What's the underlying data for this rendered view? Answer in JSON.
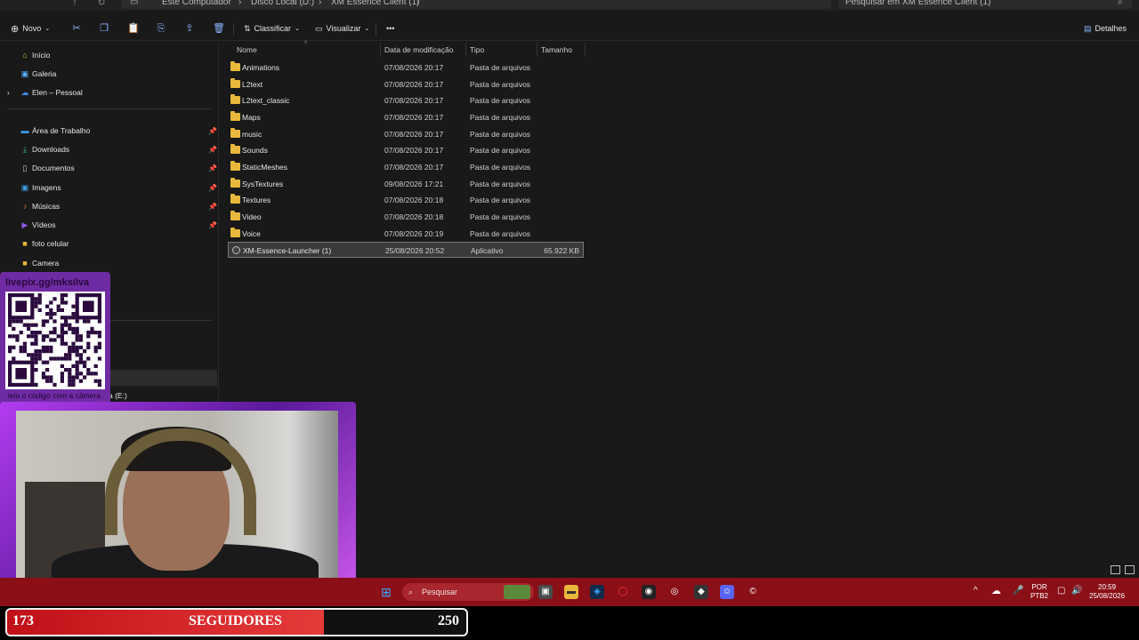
{
  "address": {
    "crumbs": [
      "Este Computador",
      "Disco Local (D:)",
      "XM Essence Client (1)"
    ],
    "search_placeholder": "Pesquisar em XM Essence Client (1)"
  },
  "toolbar": {
    "new_label": "Novo",
    "sort_label": "Classificar",
    "view_label": "Visualizar",
    "more_label": "•••",
    "details_label": "Detalhes"
  },
  "nav": {
    "items": [
      {
        "label": "Início",
        "icon": "home-icon",
        "color": "#e8b83c"
      },
      {
        "label": "Galeria",
        "icon": "gallery-icon",
        "color": "#5ab0ff"
      },
      {
        "label": "Elen – Pessoal",
        "icon": "cloud-icon",
        "color": "#3a8ee8"
      },
      {
        "label": "Área de Trabalho",
        "icon": "desktop-icon",
        "color": "#3a9ee8"
      },
      {
        "label": "Downloads",
        "icon": "download-icon",
        "color": "#3ac89a"
      },
      {
        "label": "Documentos",
        "icon": "document-icon",
        "color": "#c8c8c8"
      },
      {
        "label": "Imagens",
        "icon": "image-icon",
        "color": "#3a9ee8"
      },
      {
        "label": "Músicas",
        "icon": "music-icon",
        "color": "#e86a4a"
      },
      {
        "label": "Vídeos",
        "icon": "video-icon",
        "color": "#8a5ae8"
      },
      {
        "label": "foto celular",
        "icon": "folder-icon",
        "color": "#e8b83c"
      },
      {
        "label": "Camera",
        "icon": "folder-icon",
        "color": "#e8b83c"
      }
    ],
    "drive_label": "a (E:)"
  },
  "columns": {
    "name": "Nome",
    "modified": "Data de modificação",
    "type": "Tipo",
    "size": "Tamanho"
  },
  "files": [
    {
      "name": "Animations",
      "modified": "07/08/2026 20:17",
      "type": "Pasta de arquivos",
      "size": ""
    },
    {
      "name": "L2text",
      "modified": "07/08/2026 20:17",
      "type": "Pasta de arquivos",
      "size": ""
    },
    {
      "name": "L2text_classic",
      "modified": "07/08/2026 20:17",
      "type": "Pasta de arquivos",
      "size": ""
    },
    {
      "name": "Maps",
      "modified": "07/08/2026 20:17",
      "type": "Pasta de arquivos",
      "size": ""
    },
    {
      "name": "music",
      "modified": "07/08/2026 20:17",
      "type": "Pasta de arquivos",
      "size": ""
    },
    {
      "name": "Sounds",
      "modified": "07/08/2026 20:17",
      "type": "Pasta de arquivos",
      "size": ""
    },
    {
      "name": "StaticMeshes",
      "modified": "07/08/2026 20:17",
      "type": "Pasta de arquivos",
      "size": ""
    },
    {
      "name": "SysTextures",
      "modified": "09/08/2026 17:21",
      "type": "Pasta de arquivos",
      "size": ""
    },
    {
      "name": "Textures",
      "modified": "07/08/2026 20:18",
      "type": "Pasta de arquivos",
      "size": ""
    },
    {
      "name": "Video",
      "modified": "07/08/2026 20:18",
      "type": "Pasta de arquivos",
      "size": ""
    },
    {
      "name": "Voice",
      "modified": "07/08/2026 20:19",
      "type": "Pasta de arquivos",
      "size": ""
    },
    {
      "name": "XM-Essence-Launcher (1)",
      "modified": "25/08/2026 20:52",
      "type": "Aplicativo",
      "size": "65.922 KB"
    }
  ],
  "overlay": {
    "qr_link": "livepix.gg/mksilva",
    "qr_caption": "leia o código com a câmera do celular."
  },
  "taskbar": {
    "search_label": "Pesquisar",
    "lang_top": "POR",
    "lang_bottom": "PTB2",
    "time": "20:59",
    "date": "25/08/2026"
  },
  "followers": {
    "current": "173",
    "label": "SEGUIDORES",
    "goal": "250",
    "progress": 0.69
  }
}
